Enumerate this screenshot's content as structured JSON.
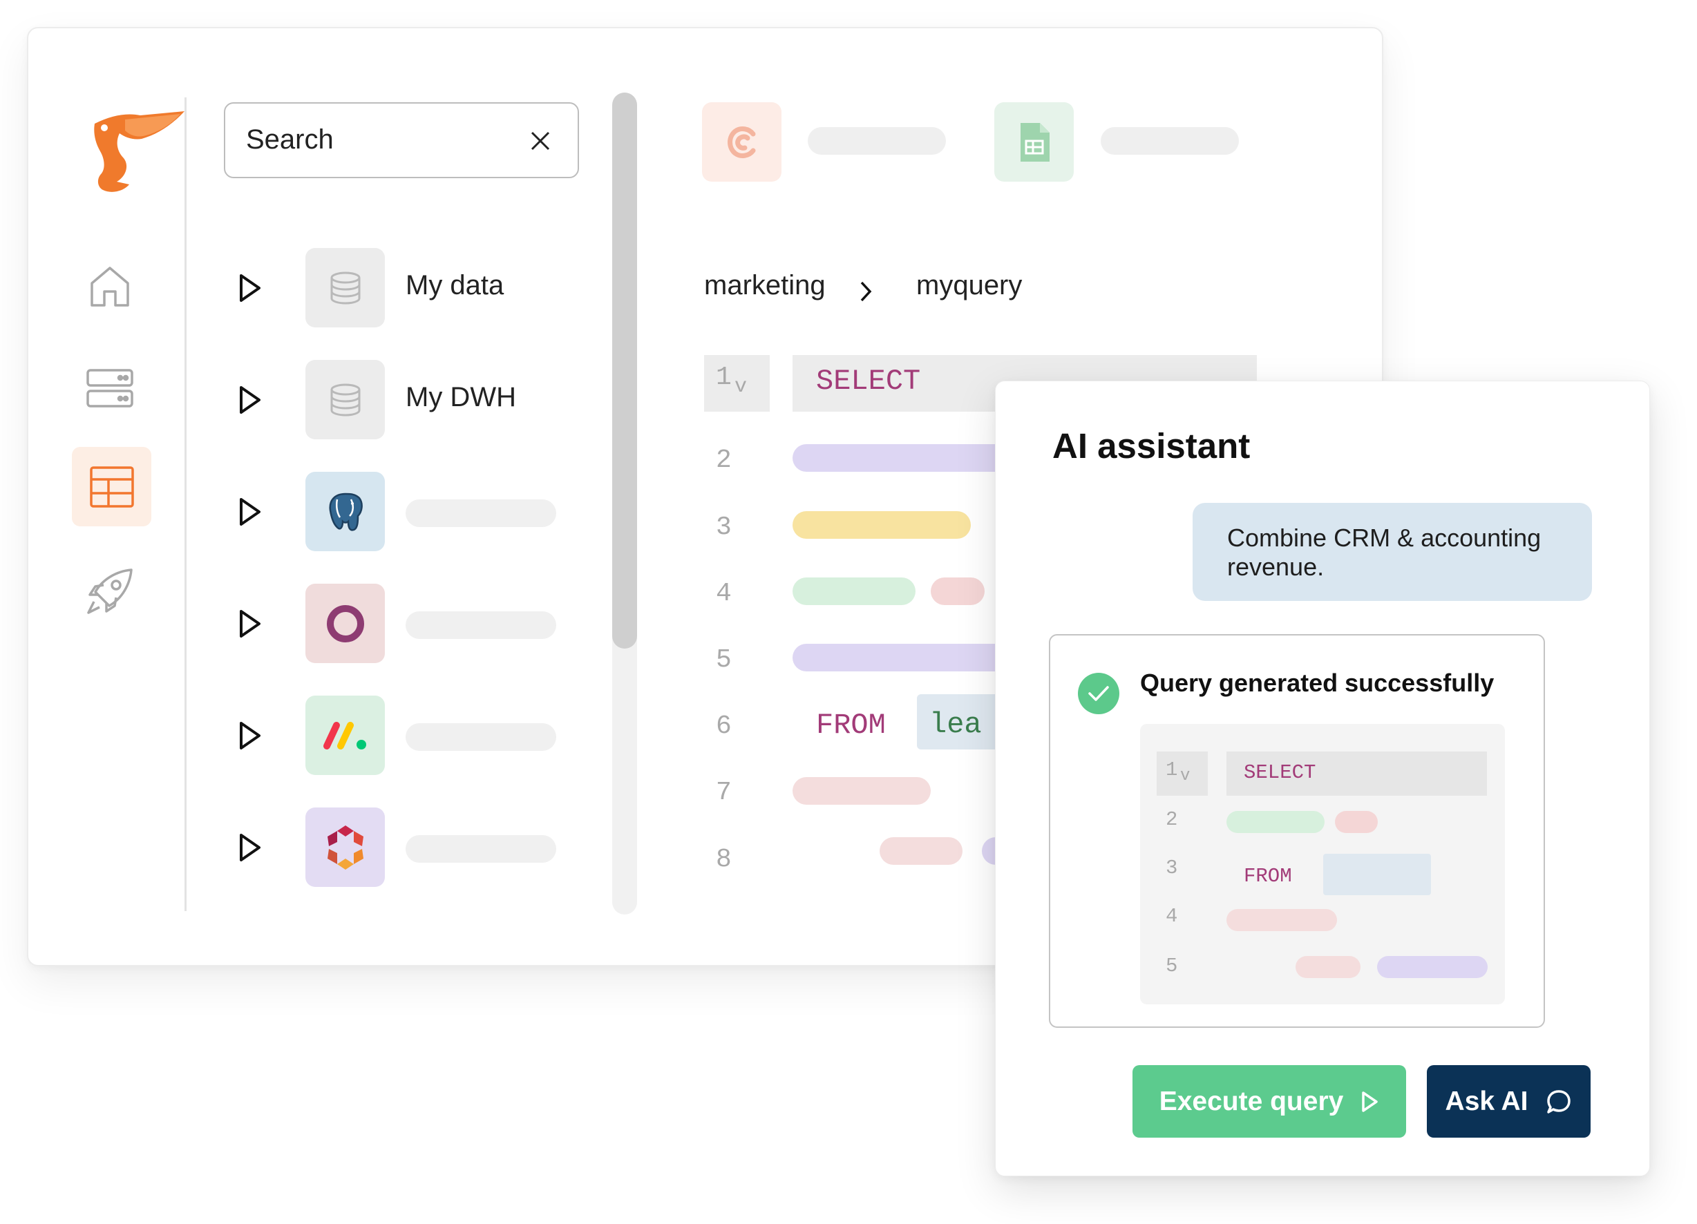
{
  "search": {
    "value": "Search"
  },
  "sidebar": {
    "nav": [
      {
        "icon": "home-icon"
      },
      {
        "icon": "server-icon"
      },
      {
        "icon": "table-icon",
        "active": true
      },
      {
        "icon": "rocket-icon"
      }
    ]
  },
  "tree": {
    "items": [
      {
        "label": "My data",
        "icon": "database-icon"
      },
      {
        "label": "My DWH",
        "icon": "database-icon"
      },
      {
        "label": "",
        "icon": "postgresql-icon"
      },
      {
        "label": "",
        "icon": "ring-logo-icon"
      },
      {
        "label": "",
        "icon": "monday-logo-icon"
      },
      {
        "label": "",
        "icon": "hexagon-logo-icon"
      }
    ]
  },
  "breadcrumb": {
    "folder": "marketing",
    "file": "myquery"
  },
  "editor": {
    "line_numbers": [
      "1",
      "2",
      "3",
      "4",
      "5",
      "6",
      "7",
      "8"
    ],
    "fold_marker": "v",
    "keyword_select": "SELECT",
    "keyword_from": "FROM",
    "table_fragment": "lea"
  },
  "ai_assistant": {
    "title": "AI assistant",
    "user_message": "Combine CRM & accounting revenue.",
    "status": "Query generated successfully",
    "preview": {
      "line_numbers": [
        "1",
        "2",
        "3",
        "4",
        "5"
      ],
      "fold_marker": "v",
      "keyword_select": "SELECT",
      "keyword_from": "FROM"
    },
    "execute_label": "Execute query",
    "ask_label": "Ask AI"
  },
  "colors": {
    "brand_orange": "#f2762e",
    "execute_green": "#5ccb8e",
    "ask_navy": "#0b3256",
    "keyword": "#a23b78"
  }
}
